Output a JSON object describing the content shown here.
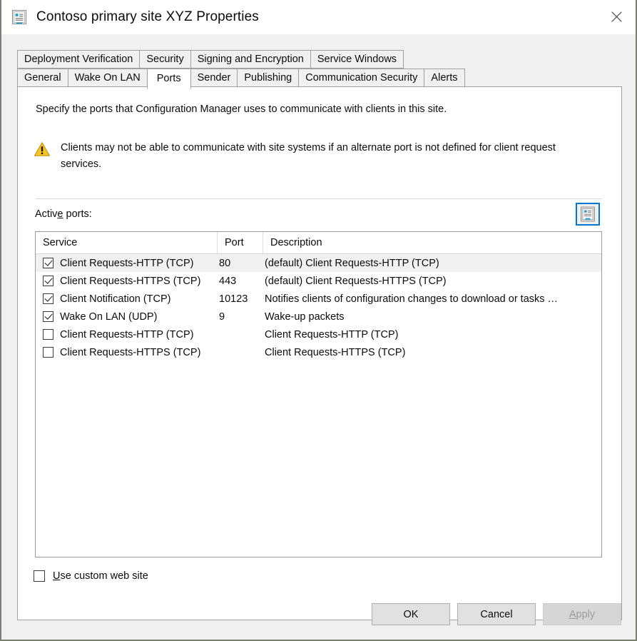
{
  "window": {
    "title": "Contoso primary site XYZ Properties",
    "icon": "site-properties-icon",
    "close_label": "✕"
  },
  "tabs": {
    "row1": [
      {
        "label": "Deployment Verification",
        "selected": false
      },
      {
        "label": "Security",
        "selected": false
      },
      {
        "label": "Signing and Encryption",
        "selected": false
      },
      {
        "label": "Service Windows",
        "selected": false
      }
    ],
    "row2": [
      {
        "label": "General",
        "selected": false
      },
      {
        "label": "Wake On LAN",
        "selected": false
      },
      {
        "label": "Ports",
        "selected": true
      },
      {
        "label": "Sender",
        "selected": false
      },
      {
        "label": "Publishing",
        "selected": false
      },
      {
        "label": "Communication Security",
        "selected": false
      },
      {
        "label": "Alerts",
        "selected": false
      }
    ]
  },
  "page": {
    "intro": "Specify the ports that Configuration Manager uses to communicate with clients in this site.",
    "warning": {
      "icon": "warning-triangle-icon",
      "text": "Clients may not be able to communicate with site systems if an alternate port is not defined for client request services."
    },
    "active_ports_label_pre": "Activ",
    "active_ports_label_accel": "e",
    "active_ports_label_post": " ports:",
    "properties_button_icon": "port-properties-icon"
  },
  "table": {
    "columns": [
      "Service",
      "Port",
      "Description"
    ],
    "rows": [
      {
        "checked": true,
        "service": "Client Requests-HTTP (TCP)",
        "port": "80",
        "description": "(default) Client Requests-HTTP (TCP)",
        "highlight": true
      },
      {
        "checked": true,
        "service": "Client Requests-HTTPS (TCP)",
        "port": "443",
        "description": "(default) Client Requests-HTTPS (TCP)",
        "highlight": false
      },
      {
        "checked": true,
        "service": "Client Notification (TCP)",
        "port": "10123",
        "description": "Notifies clients of configuration changes to download or tasks …",
        "highlight": false
      },
      {
        "checked": true,
        "service": "Wake On LAN (UDP)",
        "port": "9",
        "description": "Wake-up packets",
        "highlight": false
      },
      {
        "checked": false,
        "service": "Client Requests-HTTP (TCP)",
        "port": "",
        "description": "Client Requests-HTTP (TCP)",
        "highlight": false
      },
      {
        "checked": false,
        "service": "Client Requests-HTTPS (TCP)",
        "port": "",
        "description": "Client Requests-HTTPS (TCP)",
        "highlight": false
      }
    ]
  },
  "use_custom_web_site": {
    "checked": false,
    "label_accel": "U",
    "label_rest": "se custom web site"
  },
  "footer": {
    "ok": "OK",
    "cancel": "Cancel",
    "apply_accel": "A",
    "apply_rest": "pply",
    "apply_enabled": false
  },
  "colors": {
    "accent": "#0078d7",
    "window_border": "#7a7f6e",
    "dialog_bg": "#f0f0f0",
    "panel_bg": "#ffffff",
    "warning_yellow": "#f5c518",
    "row_highlight": "#f1f1f1"
  }
}
